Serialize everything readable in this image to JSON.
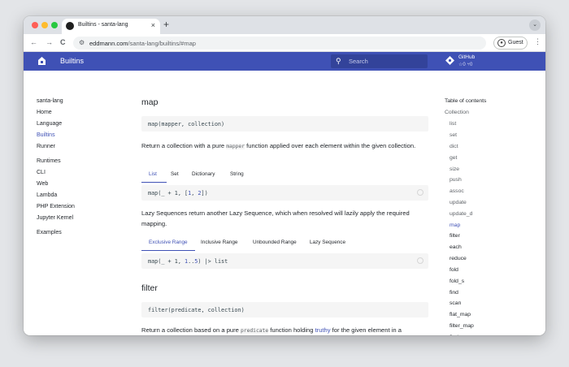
{
  "browser": {
    "tab_title": "Builtins - santa-lang",
    "tab_close": "×",
    "new_tab": "+",
    "tab_menu": "⌄",
    "back": "←",
    "forward": "→",
    "reload": "C",
    "url_host": "eddmann.com",
    "url_path": "/santa-lang/builtins/#map",
    "guest_label": "Guest",
    "menu": "⋮"
  },
  "header": {
    "title": "Builtins",
    "search_placeholder": "Search",
    "github_name": "GitHub",
    "github_stats": "☆0 ⑂0",
    "bg_color": "#3f51b5"
  },
  "sidebar": {
    "items": [
      {
        "label": "santa-lang",
        "state": "normal"
      },
      {
        "label": "Home",
        "state": "normal"
      },
      {
        "label": "Language",
        "state": "normal"
      },
      {
        "label": "Builtins",
        "state": "active"
      },
      {
        "label": "Runner",
        "state": "normal"
      },
      {
        "label": "Runtimes",
        "state": "normal"
      },
      {
        "label": "CLI",
        "state": "normal"
      },
      {
        "label": "Web",
        "state": "normal"
      },
      {
        "label": "Lambda",
        "state": "normal"
      },
      {
        "label": "PHP Extension",
        "state": "normal"
      },
      {
        "label": "Jupyter Kernel",
        "state": "normal"
      },
      {
        "label": "Examples",
        "state": "normal"
      }
    ]
  },
  "main": {
    "map_title": "map",
    "map_signature": "map(mapper, collection)",
    "map_desc_1": "Return a collection with a pure ",
    "map_desc_code": "mapper",
    "map_desc_2": " function applied over each element within the given collection.",
    "example_tabs": [
      "List",
      "Set",
      "Dictionary",
      "String"
    ],
    "example_1_a": "map(_ + 1, [",
    "example_1_n1": "1",
    "example_1_b": ", ",
    "example_1_n2": "2",
    "example_1_c": "])",
    "lazy_desc": "Lazy Sequences return another Lazy Sequence, which when resolved will lazily apply the required mapping.",
    "range_tabs": [
      "Exclusive Range",
      "Inclusive Range",
      "Unbounded Range",
      "Lazy Sequence"
    ],
    "example_2_a": "map(_ + 1, ",
    "example_2_n1": "1",
    "example_2_b": "..",
    "example_2_n2": "5",
    "example_2_c": ") |> list",
    "filter_title": "filter",
    "filter_signature": "filter(predicate, collection)",
    "filter_desc_1": "Return a collection based on a pure ",
    "filter_desc_code": "predicate",
    "filter_desc_2": " function holding ",
    "filter_desc_link": "truthy",
    "filter_desc_3": " for the given element in a collection."
  },
  "toc": {
    "heading": "Table of contents",
    "items": [
      {
        "label": "Collection",
        "state": "dim"
      },
      {
        "label": "list",
        "state": "dim"
      },
      {
        "label": "set",
        "state": "dim"
      },
      {
        "label": "dict",
        "state": "dim"
      },
      {
        "label": "get",
        "state": "dim"
      },
      {
        "label": "size",
        "state": "dim"
      },
      {
        "label": "push",
        "state": "dim"
      },
      {
        "label": "assoc",
        "state": "dim"
      },
      {
        "label": "update",
        "state": "dim"
      },
      {
        "label": "update_d",
        "state": "dim"
      },
      {
        "label": "map",
        "state": "active"
      },
      {
        "label": "filter",
        "state": "dark"
      },
      {
        "label": "each",
        "state": "dark"
      },
      {
        "label": "reduce",
        "state": "dark"
      },
      {
        "label": "fold",
        "state": "dark"
      },
      {
        "label": "fold_s",
        "state": "dark"
      },
      {
        "label": "find",
        "state": "dark"
      },
      {
        "label": "scan",
        "state": "dark"
      },
      {
        "label": "flat_map",
        "state": "dark"
      },
      {
        "label": "filter_map",
        "state": "dark"
      },
      {
        "label": "find_map",
        "state": "dark"
      }
    ]
  }
}
